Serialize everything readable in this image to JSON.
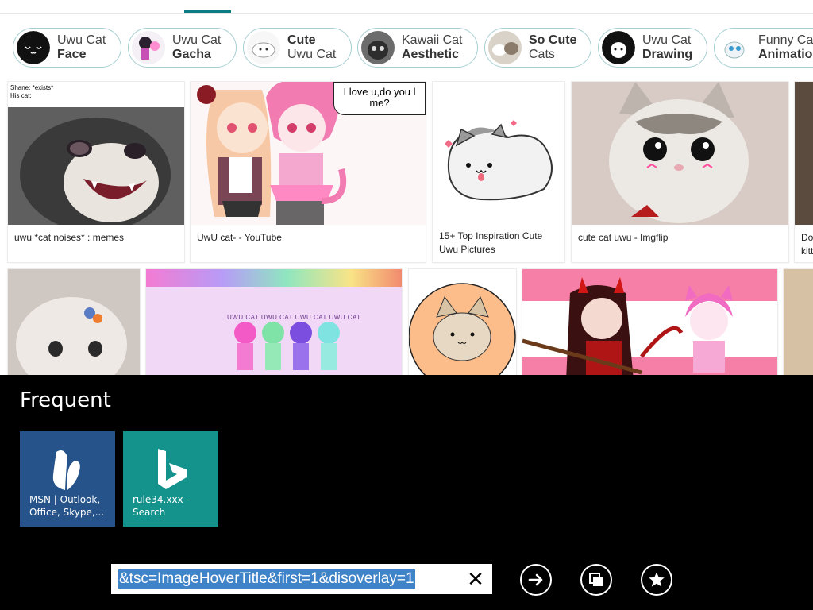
{
  "chips": [
    {
      "line1": "Uwu Cat",
      "line2": "Face",
      "bold": 2
    },
    {
      "line1": "Uwu Cat",
      "line2": "Gacha",
      "bold": 2
    },
    {
      "line1": "Cute",
      "line2": "Uwu Cat",
      "bold": 1
    },
    {
      "line1": "Kawaii Cat",
      "line2": "Aesthetic",
      "bold": 2
    },
    {
      "line1": "So Cute",
      "line2": "Cats",
      "bold": 1
    },
    {
      "line1": "Uwu Cat",
      "line2": "Drawing",
      "bold": 2
    },
    {
      "line1": "Funny Cat",
      "line2": "Animation",
      "bold": 2
    }
  ],
  "results_row1": [
    {
      "caption": "uwu *cat noises* : memes",
      "meme_top": "Shane: *exists*",
      "meme_bottom": "His cat:"
    },
    {
      "caption": "UwU cat- - YouTube",
      "bubble": "I love u,do you l\nme?"
    },
    {
      "caption": "15+ Top Inspiration Cute Uwu Pictures"
    },
    {
      "caption": "cute cat uwu - Imgflip"
    },
    {
      "caption": "Do\nkitt"
    }
  ],
  "results_row2_overlay_text": "UWU CAT UWU CAT UWU CAT UWU CAT",
  "overlay": {
    "section_title": "Frequent",
    "tiles": [
      {
        "label": "MSN | Outlook, Office, Skype,...",
        "color": "#26538a",
        "icon": "msn-butterfly-icon"
      },
      {
        "label": "rule34.xxx - Search",
        "color": "#14938c",
        "icon": "bing-logo-icon"
      }
    ],
    "address": {
      "url": "&tsc=ImageHoverTitle&first=1&disoverlay=1",
      "clear_glyph": "✕"
    },
    "buttons": {
      "go": "go-arrow-icon",
      "tabs": "tabs-icon",
      "favorites": "star-icon"
    }
  },
  "colors": {
    "accent": "#0c7c84",
    "chip_border": "#a7cfd2",
    "selection": "#3f83c8"
  }
}
